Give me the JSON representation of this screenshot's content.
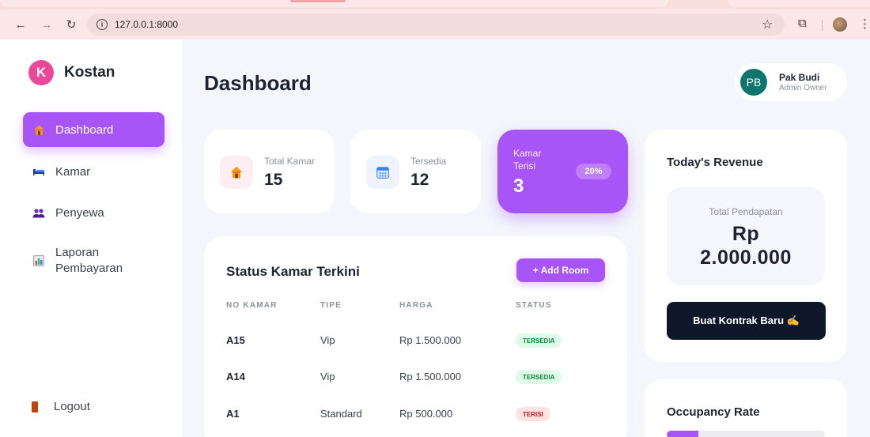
{
  "browser": {
    "url": "127.0.0.1:8000"
  },
  "sidebar": {
    "brand_initial": "K",
    "brand_name": "Kostan",
    "items": [
      {
        "label": "Dashboard",
        "icon": "house-icon",
        "active": true
      },
      {
        "label": "Kamar",
        "icon": "bed-icon",
        "active": false
      },
      {
        "label": "Penyewa",
        "icon": "people-icon",
        "active": false
      },
      {
        "label": "Laporan Pembayaran",
        "label_line1": "Laporan",
        "label_line2": "Pembayaran",
        "icon": "bar-chart-icon",
        "active": false
      }
    ],
    "logout_label": "Logout"
  },
  "header": {
    "title": "Dashboard",
    "user": {
      "initials": "PB",
      "name": "Pak Budi",
      "role": "Admin Owner"
    }
  },
  "stats": [
    {
      "label": "Total Kamar",
      "value": "15",
      "icon": "house-icon"
    },
    {
      "label": "Tersedia",
      "value": "12",
      "icon": "calendar-icon"
    },
    {
      "label": "Kamar Terisi",
      "value": "3",
      "badge": "20%"
    }
  ],
  "status_table": {
    "title": "Status Kamar Terkini",
    "add_button": "+ Add Room",
    "columns": [
      "NO KAMAR",
      "TIPE",
      "HARGA",
      "STATUS"
    ],
    "rows": [
      {
        "no": "A15",
        "tipe": "Vip",
        "harga": "Rp 1.500.000",
        "status": "TERSEDIA"
      },
      {
        "no": "A14",
        "tipe": "Vip",
        "harga": "Rp 1.500.000",
        "status": "TERSEDIA"
      },
      {
        "no": "A1",
        "tipe": "Standard",
        "harga": "Rp 500.000",
        "status": "TERISI"
      }
    ]
  },
  "revenue": {
    "title": "Today's Revenue",
    "label": "Total Pendapatan",
    "currency": "Rp",
    "amount": "2.000.000",
    "button": "Buat Kontrak Baru ✍️"
  },
  "occupancy": {
    "title": "Occupancy Rate",
    "fraction": 0.2
  },
  "colors": {
    "accent": "#a855f7",
    "brand": "#ec4899",
    "dark_button": "#0f172a",
    "available": "#15803d",
    "occupied": "#b91c1c"
  }
}
